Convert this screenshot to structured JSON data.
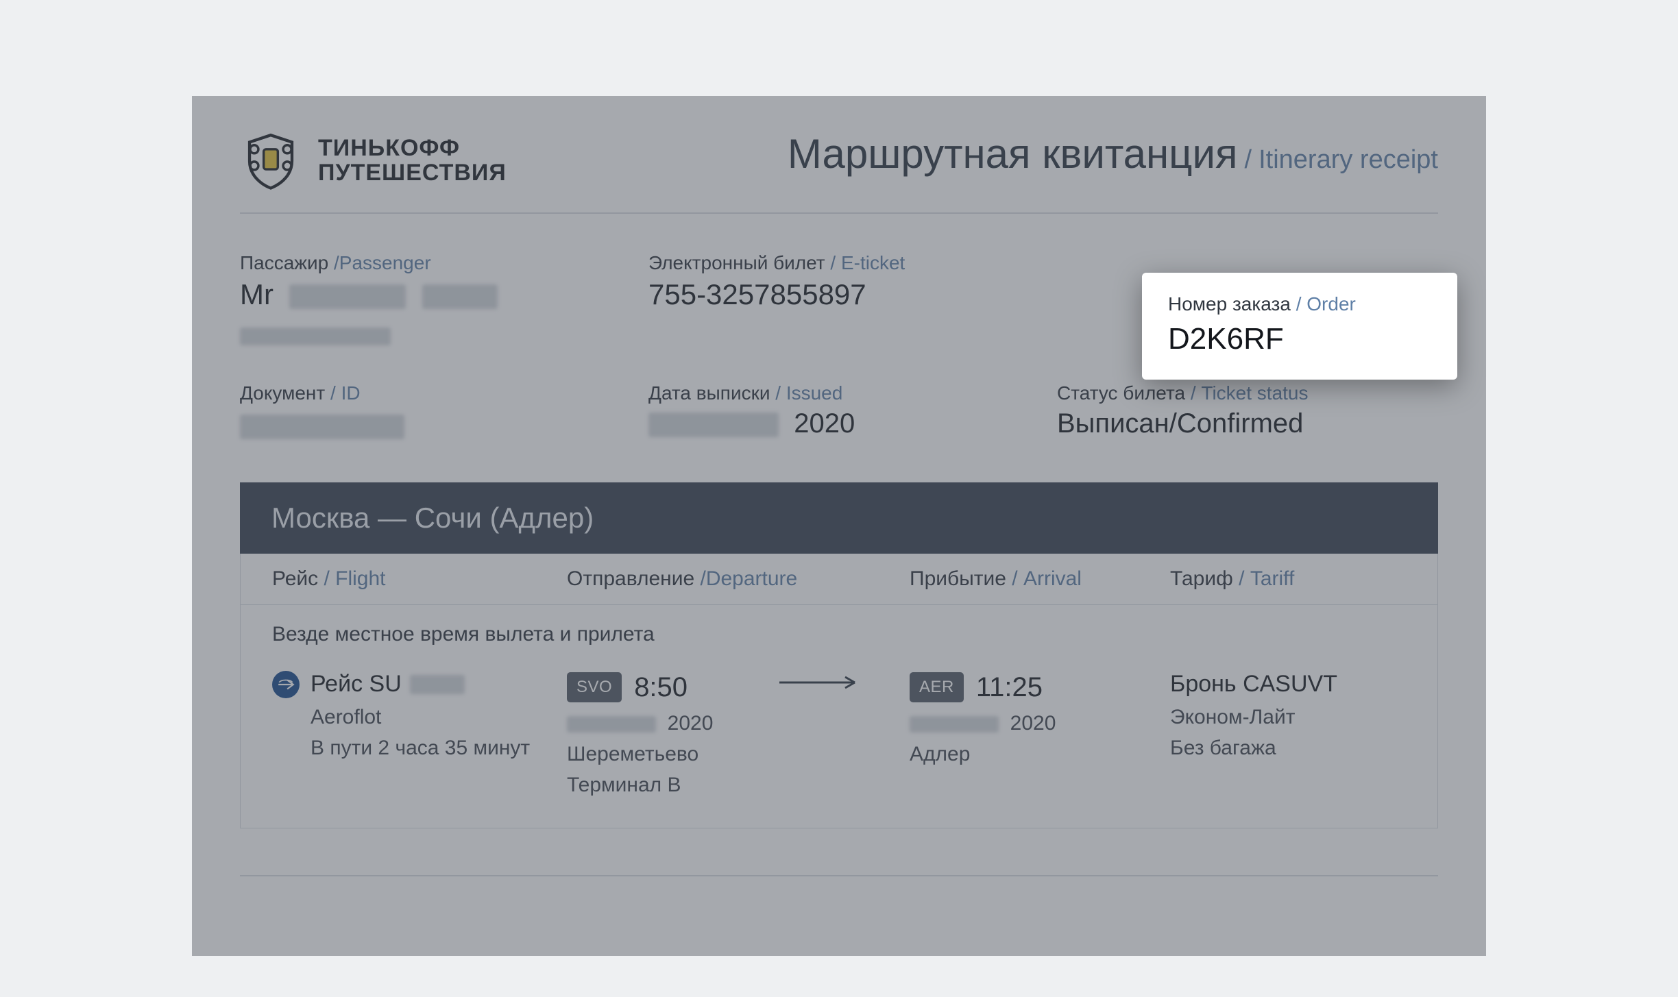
{
  "brand": {
    "line1": "ТИНЬКОФФ",
    "line2": "ПУТЕШЕСТВИЯ"
  },
  "title": {
    "ru": "Маршрутная квитанция",
    "en": "Itinerary receipt"
  },
  "fields": {
    "passenger": {
      "label_ru": "Пассажир",
      "label_en": "Passenger",
      "prefix": "Mr"
    },
    "eticket": {
      "label_ru": "Электронный билет",
      "label_en": "E-ticket",
      "value": "755-3257855897"
    },
    "order": {
      "label_ru": "Номер заказа",
      "label_en": "Order",
      "value": "D2K6RF"
    },
    "document": {
      "label_ru": "Документ",
      "label_en": "ID"
    },
    "issued": {
      "label_ru": "Дата выписки",
      "label_en": "Issued",
      "year": "2020"
    },
    "status": {
      "label_ru": "Статус билета",
      "label_en": "Ticket status",
      "value": "Выписан/Confirmed"
    }
  },
  "route_title": "Москва — Сочи (Адлер)",
  "table_head": {
    "flight": {
      "ru": "Рейс",
      "en": "Flight"
    },
    "departure": {
      "ru": "Отправление",
      "en": "Departure"
    },
    "arrival": {
      "ru": "Прибытие",
      "en": "Arrival"
    },
    "tariff": {
      "ru": "Тариф",
      "en": "Tariff"
    }
  },
  "localtime_note": "Везде местное время вылета и прилета",
  "flight": {
    "flight_prefix": "Рейс SU",
    "airline": "Aeroflot",
    "duration": "В пути 2 часа 35 минут",
    "dep": {
      "iata": "SVO",
      "time": "8:50",
      "year": "2020",
      "airport": "Шереметьево",
      "terminal": "Терминал B"
    },
    "arr": {
      "iata": "AER",
      "time": "11:25",
      "year": "2020",
      "airport": "Адлер"
    },
    "tariff": {
      "booking": "Бронь CASUVT",
      "class": "Эконом-Лайт",
      "baggage": "Без багажа"
    }
  }
}
